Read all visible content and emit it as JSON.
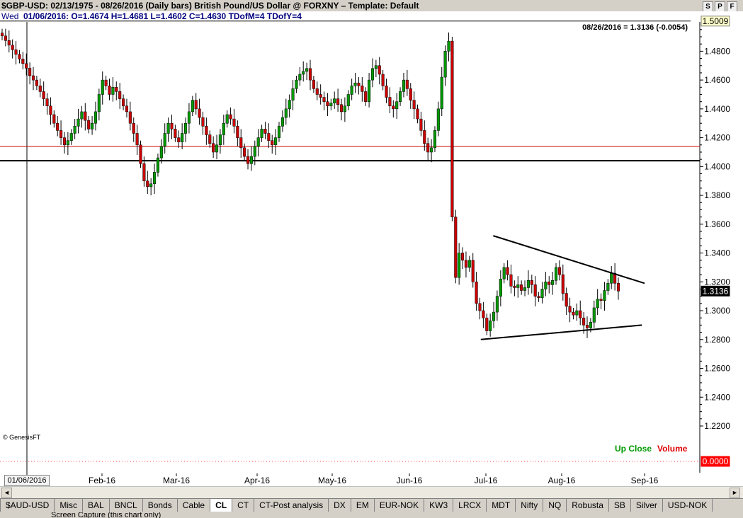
{
  "window": {
    "title": "$GBP-USD:  02/13/1975 - 08/26/2016  (Daily bars)   British Pound/US Dollar @ FORXNY  –  Template: Default",
    "buttons": [
      "S",
      "P",
      "F"
    ]
  },
  "info": {
    "day": "Wed",
    "ohlc": "01/06/2016:  O=1.4674   H=1.4681   L=1.4602   C=1.4630   TDofM=4   TDofY=4"
  },
  "last_bar": "08/26/2016 = 1.3136 (-0.0054)",
  "legend": {
    "up": "Up Close",
    "volume": "Volume"
  },
  "copyright": "© GenesisFT",
  "cursor_date": "01/06/2016",
  "status": "Screen Capture (this chart only)",
  "tabs": [
    "$AUD-USD",
    "Misc",
    "BAL",
    "BNCL",
    "Bonds",
    "Cable",
    "CL",
    "CT",
    "CT-Post analysis",
    "DX",
    "EM",
    "EUR-NOK",
    "KW3",
    "LRCX",
    "MDT",
    "Nifty",
    "NQ",
    "Robusta",
    "SB",
    "Silver",
    "USD-NOK"
  ],
  "active_tab": "CL",
  "colors": {
    "up": "#009900",
    "down": "#cc0000",
    "price_box": "#000000",
    "resistance": "#cc0000",
    "support": "#000000"
  },
  "chart_data": {
    "type": "candlestick",
    "title": "$GBP-USD",
    "ylim": [
      1.18,
      1.51
    ],
    "y_ticks": [
      "1.4800",
      "1.4600",
      "1.4400",
      "1.4200",
      "1.4000",
      "1.3800",
      "1.3600",
      "1.3400",
      "1.3200",
      "1.3000",
      "1.2800",
      "1.2600",
      "1.2400",
      "1.2200"
    ],
    "x_ticks": [
      "Feb-16",
      "Mar-16",
      "Apr-16",
      "May-16",
      "Jun-16",
      "Jul-16",
      "Aug-16",
      "Sep-16"
    ],
    "price_labels": {
      "high": "1.5009",
      "last": "1.3136",
      "volume_zero": "0.0000"
    },
    "horizontal_lines": [
      {
        "name": "high",
        "value": 1.5009
      },
      {
        "name": "resistance",
        "value": 1.414
      },
      {
        "name": "support",
        "value": 1.404
      }
    ],
    "trendlines": [
      {
        "name": "upper",
        "from": [
          "2016-07-04",
          1.352
        ],
        "to": [
          "2016-09-01",
          1.319
        ]
      },
      {
        "name": "lower",
        "from": [
          "2016-06-29",
          1.28
        ],
        "to": [
          "2016-08-31",
          1.29
        ]
      }
    ],
    "series": [
      {
        "close": [
          1.4906,
          1.4874,
          1.4842,
          1.481,
          1.4778,
          1.4746,
          1.4714,
          1.4682,
          1.463,
          1.46,
          1.456,
          1.452,
          1.447,
          1.442,
          1.436,
          1.43,
          1.425,
          1.42,
          1.415,
          1.418,
          1.423,
          1.428,
          1.433,
          1.438,
          1.432,
          1.426,
          1.43,
          1.438,
          1.45,
          1.46,
          1.456,
          1.45,
          1.455,
          1.452,
          1.447,
          1.442,
          1.438,
          1.43,
          1.423,
          1.415,
          1.402,
          1.39,
          1.386,
          1.388,
          1.396,
          1.406,
          1.414,
          1.423,
          1.43,
          1.426,
          1.42,
          1.417,
          1.423,
          1.43,
          1.438,
          1.446,
          1.44,
          1.434,
          1.428,
          1.422,
          1.416,
          1.41,
          1.415,
          1.422,
          1.43,
          1.436,
          1.433,
          1.428,
          1.42,
          1.413,
          1.407,
          1.402,
          1.407,
          1.414,
          1.42,
          1.426,
          1.423,
          1.418,
          1.415,
          1.42,
          1.428,
          1.434,
          1.44,
          1.446,
          1.454,
          1.46,
          1.464,
          1.466,
          1.468,
          1.46,
          1.454,
          1.45,
          1.448,
          1.445,
          1.442,
          1.444,
          1.447,
          1.443,
          1.438,
          1.442,
          1.45,
          1.456,
          1.458,
          1.456,
          1.452,
          1.445,
          1.46,
          1.468,
          1.47,
          1.464,
          1.456,
          1.448,
          1.442,
          1.44,
          1.445,
          1.452,
          1.46,
          1.454,
          1.446,
          1.44,
          1.433,
          1.425,
          1.416,
          1.41,
          1.413,
          1.425,
          1.44,
          1.462,
          1.48,
          1.487,
          1.365,
          1.323,
          1.34,
          1.335,
          1.33,
          1.335,
          1.32,
          1.305,
          1.3,
          1.295,
          1.286,
          1.293,
          1.299,
          1.31,
          1.322,
          1.33,
          1.325,
          1.317,
          1.316,
          1.318,
          1.314,
          1.316,
          1.321,
          1.318,
          1.31,
          1.309,
          1.315,
          1.32,
          1.318,
          1.321,
          1.33,
          1.325,
          1.312,
          1.303,
          1.299,
          1.297,
          1.3,
          1.295,
          1.29,
          1.288,
          1.292,
          1.302,
          1.308,
          1.307,
          1.314,
          1.319,
          1.326,
          1.319,
          1.3136
        ]
      }
    ]
  }
}
